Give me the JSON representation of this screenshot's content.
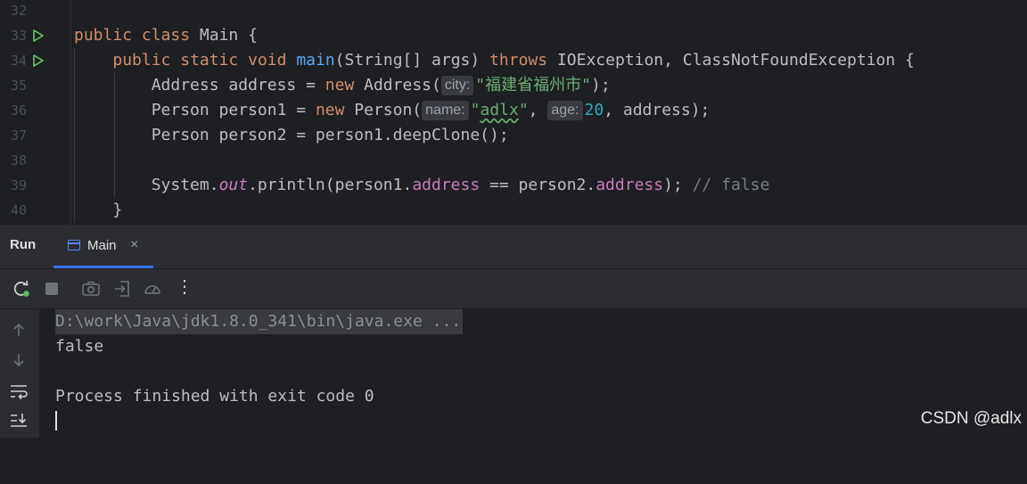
{
  "editor": {
    "line_numbers": [
      "32",
      "33",
      "34",
      "35",
      "36",
      "37",
      "38",
      "39",
      "40"
    ],
    "lines": {
      "l33": {
        "kw1": "public",
        "kw2": "class",
        "rest": " Main {"
      },
      "l34": {
        "kw1": "public",
        "kw2": "static",
        "kw3": "void",
        "fn": "main",
        "args": "(String[] args) ",
        "throws": "throws",
        "rest": " IOException, ClassNotFoundException {"
      },
      "l35": {
        "pre": "Address address = ",
        "kw": "new",
        "mid": " Address(",
        "hint": "city:",
        "str": "\"福建省福州市\"",
        "post": ");"
      },
      "l36": {
        "pre": "Person person1 = ",
        "kw": "new",
        "mid": " Person(",
        "hint1": "name:",
        "str_q1": "\"",
        "str_word": "adlx",
        "str_q2": "\"",
        "comma": ", ",
        "hint2": "age:",
        "num": "20",
        "post": ", address);"
      },
      "l37": {
        "text": "Person person2 = person1.deepClone();"
      },
      "l39": {
        "pre": "System.",
        "out": "out",
        "mid": ".println(person1.",
        "f1": "address",
        "eq": " == person2.",
        "f2": "address",
        "post": "); ",
        "comment": "// false"
      },
      "l40": {
        "text": "}"
      }
    },
    "gutter_icons": [
      "run-icon",
      "run-icon"
    ]
  },
  "runwindow": {
    "title": "Run",
    "tab_label": "Main",
    "tab_close": "×",
    "toolbar_icons": [
      "rerun-icon",
      "stop-icon",
      "screenshot-icon",
      "import-icon",
      "profiler-icon",
      "more-icon"
    ],
    "more_glyph": "⋮",
    "sidebar_icons": [
      "up-arrow-icon",
      "down-arrow-icon",
      "soft-wrap-icon",
      "scroll-to-end-icon"
    ],
    "console": {
      "cmd": "D:\\work\\Java\\jdk1.8.0_341\\bin\\java.exe ...",
      "output": "false",
      "exit": "Process finished with exit code 0"
    }
  },
  "watermark": "CSDN @adlx",
  "colors": {
    "accent": "#3574f0",
    "run_green": "#5fb865",
    "keyword": "#cf8e6d",
    "string": "#6aab73"
  }
}
